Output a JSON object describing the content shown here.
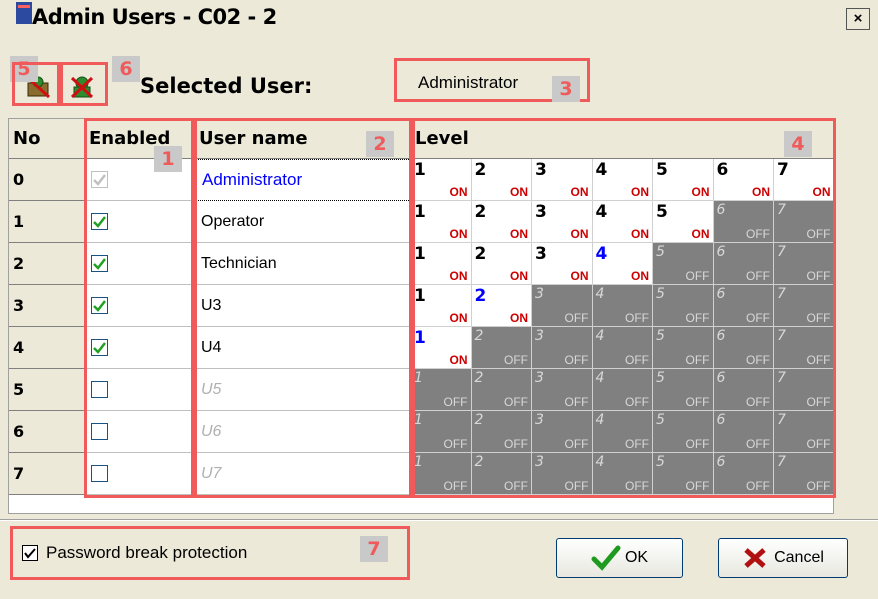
{
  "window": {
    "title": "Admin Users - C02 - 2",
    "close_glyph": "×"
  },
  "toolbar": {
    "buttons": [
      {
        "icon": "user-add-icon"
      },
      {
        "icon": "user-delete-icon"
      }
    ],
    "selected_user_label": "Selected User:",
    "selected_user_value": "Administrator"
  },
  "grid": {
    "headers": {
      "no": "No",
      "enabled": "Enabled",
      "user_name": "User name",
      "level": "Level"
    },
    "rows": [
      {
        "no": "0",
        "enabled": true,
        "enabled_state": "disabled",
        "name": "Administrator",
        "name_style": "selected",
        "max_level": 7
      },
      {
        "no": "1",
        "enabled": true,
        "enabled_state": "normal",
        "name": "Operator",
        "name_style": "normal",
        "max_level": 5
      },
      {
        "no": "2",
        "enabled": true,
        "enabled_state": "normal",
        "name": "Technician",
        "name_style": "normal",
        "max_level": 4
      },
      {
        "no": "3",
        "enabled": true,
        "enabled_state": "normal",
        "name": "U3",
        "name_style": "normal",
        "max_level": 2
      },
      {
        "no": "4",
        "enabled": true,
        "enabled_state": "normal",
        "name": "U4",
        "name_style": "normal",
        "max_level": 1
      },
      {
        "no": "5",
        "enabled": false,
        "enabled_state": "normal",
        "name": "U5",
        "name_style": "disabled",
        "max_level": 0
      },
      {
        "no": "6",
        "enabled": false,
        "enabled_state": "normal",
        "name": "U6",
        "name_style": "disabled",
        "max_level": 0
      },
      {
        "no": "7",
        "enabled": false,
        "enabled_state": "normal",
        "name": "U7",
        "name_style": "disabled",
        "max_level": 0
      }
    ],
    "level_on": "ON",
    "level_off": "OFF"
  },
  "callouts": [
    "1",
    "2",
    "3",
    "4",
    "5",
    "6",
    "7"
  ],
  "footer": {
    "password_protection_label": "Password break protection",
    "password_protection_checked": true,
    "ok_label": "OK",
    "cancel_label": "Cancel"
  },
  "colors": {
    "callout": "#f05a5a",
    "selected_name": "#0000ff",
    "level_off_bg": "#808080",
    "on_text": "#cc0000"
  }
}
